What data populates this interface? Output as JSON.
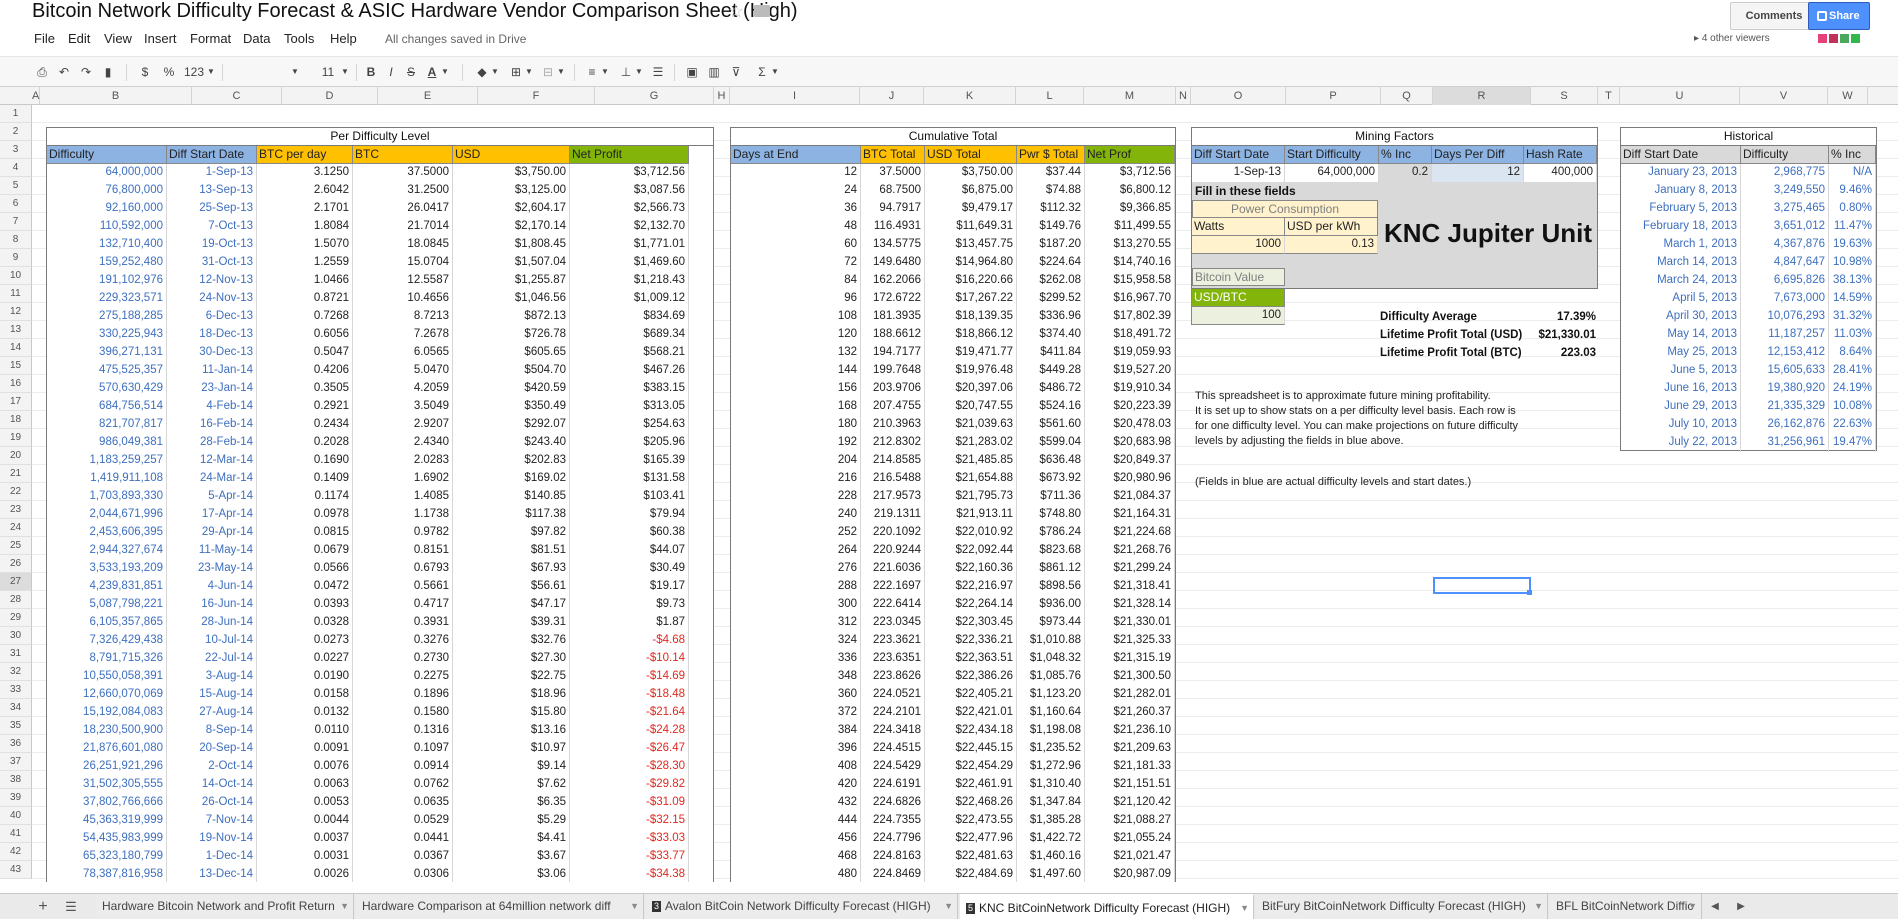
{
  "document": {
    "title": "Bitcoin Network Difficulty Forecast & ASIC Hardware Vendor Comparison Sheet (High)",
    "saved_status": "All changes saved in Drive",
    "comments_label": "Comments",
    "share_label": "Share",
    "viewers_label": "4 other viewers",
    "viewer_colors": [
      "#e8417a",
      "#c0325a",
      "#49a85c",
      "#30b84a"
    ]
  },
  "menu": [
    "File",
    "Edit",
    "View",
    "Insert",
    "Format",
    "Data",
    "Tools",
    "Help"
  ],
  "toolbar": {
    "currency": "$",
    "percent": "%",
    "number_format": "123",
    "font_size": "11"
  },
  "columns": [
    "A",
    "B",
    "C",
    "D",
    "E",
    "F",
    "G",
    "H",
    "I",
    "J",
    "K",
    "L",
    "M",
    "N",
    "O",
    "P",
    "Q",
    "R",
    "S",
    "T",
    "U",
    "V",
    "W"
  ],
  "rows": [
    "1",
    "2",
    "3",
    "4",
    "5",
    "6",
    "7",
    "8",
    "9",
    "10",
    "11",
    "12",
    "13",
    "14",
    "15",
    "16",
    "17",
    "18",
    "19",
    "20",
    "21",
    "22",
    "23",
    "24",
    "25",
    "26",
    "27",
    "28",
    "29",
    "30",
    "31",
    "32",
    "33",
    "34",
    "35",
    "36",
    "37",
    "38",
    "39",
    "40",
    "41",
    "42",
    "43"
  ],
  "selected_cell": {
    "column": "R",
    "row": "27"
  },
  "per_difficulty": {
    "title": "Per Difficulty Level",
    "headers": [
      "Difficulty",
      "Diff Start Date",
      "BTC per day",
      "BTC",
      "USD",
      "Net Profit"
    ],
    "rows": [
      [
        "64,000,000",
        "1-Sep-13",
        "3.1250",
        "37.5000",
        "$3,750.00",
        "$3,712.56"
      ],
      [
        "76,800,000",
        "13-Sep-13",
        "2.6042",
        "31.2500",
        "$3,125.00",
        "$3,087.56"
      ],
      [
        "92,160,000",
        "25-Sep-13",
        "2.1701",
        "26.0417",
        "$2,604.17",
        "$2,566.73"
      ],
      [
        "110,592,000",
        "7-Oct-13",
        "1.8084",
        "21.7014",
        "$2,170.14",
        "$2,132.70"
      ],
      [
        "132,710,400",
        "19-Oct-13",
        "1.5070",
        "18.0845",
        "$1,808.45",
        "$1,771.01"
      ],
      [
        "159,252,480",
        "31-Oct-13",
        "1.2559",
        "15.0704",
        "$1,507.04",
        "$1,469.60"
      ],
      [
        "191,102,976",
        "12-Nov-13",
        "1.0466",
        "12.5587",
        "$1,255.87",
        "$1,218.43"
      ],
      [
        "229,323,571",
        "24-Nov-13",
        "0.8721",
        "10.4656",
        "$1,046.56",
        "$1,009.12"
      ],
      [
        "275,188,285",
        "6-Dec-13",
        "0.7268",
        "8.7213",
        "$872.13",
        "$834.69"
      ],
      [
        "330,225,943",
        "18-Dec-13",
        "0.6056",
        "7.2678",
        "$726.78",
        "$689.34"
      ],
      [
        "396,271,131",
        "30-Dec-13",
        "0.5047",
        "6.0565",
        "$605.65",
        "$568.21"
      ],
      [
        "475,525,357",
        "11-Jan-14",
        "0.4206",
        "5.0470",
        "$504.70",
        "$467.26"
      ],
      [
        "570,630,429",
        "23-Jan-14",
        "0.3505",
        "4.2059",
        "$420.59",
        "$383.15"
      ],
      [
        "684,756,514",
        "4-Feb-14",
        "0.2921",
        "3.5049",
        "$350.49",
        "$313.05"
      ],
      [
        "821,707,817",
        "16-Feb-14",
        "0.2434",
        "2.9207",
        "$292.07",
        "$254.63"
      ],
      [
        "986,049,381",
        "28-Feb-14",
        "0.2028",
        "2.4340",
        "$243.40",
        "$205.96"
      ],
      [
        "1,183,259,257",
        "12-Mar-14",
        "0.1690",
        "2.0283",
        "$202.83",
        "$165.39"
      ],
      [
        "1,419,911,108",
        "24-Mar-14",
        "0.1409",
        "1.6902",
        "$169.02",
        "$131.58"
      ],
      [
        "1,703,893,330",
        "5-Apr-14",
        "0.1174",
        "1.4085",
        "$140.85",
        "$103.41"
      ],
      [
        "2,044,671,996",
        "17-Apr-14",
        "0.0978",
        "1.1738",
        "$117.38",
        "$79.94"
      ],
      [
        "2,453,606,395",
        "29-Apr-14",
        "0.0815",
        "0.9782",
        "$97.82",
        "$60.38"
      ],
      [
        "2,944,327,674",
        "11-May-14",
        "0.0679",
        "0.8151",
        "$81.51",
        "$44.07"
      ],
      [
        "3,533,193,209",
        "23-May-14",
        "0.0566",
        "0.6793",
        "$67.93",
        "$30.49"
      ],
      [
        "4,239,831,851",
        "4-Jun-14",
        "0.0472",
        "0.5661",
        "$56.61",
        "$19.17"
      ],
      [
        "5,087,798,221",
        "16-Jun-14",
        "0.0393",
        "0.4717",
        "$47.17",
        "$9.73"
      ],
      [
        "6,105,357,865",
        "28-Jun-14",
        "0.0328",
        "0.3931",
        "$39.31",
        "$1.87"
      ],
      [
        "7,326,429,438",
        "10-Jul-14",
        "0.0273",
        "0.3276",
        "$32.76",
        "-$4.68"
      ],
      [
        "8,791,715,326",
        "22-Jul-14",
        "0.0227",
        "0.2730",
        "$27.30",
        "-$10.14"
      ],
      [
        "10,550,058,391",
        "3-Aug-14",
        "0.0190",
        "0.2275",
        "$22.75",
        "-$14.69"
      ],
      [
        "12,660,070,069",
        "15-Aug-14",
        "0.0158",
        "0.1896",
        "$18.96",
        "-$18.48"
      ],
      [
        "15,192,084,083",
        "27-Aug-14",
        "0.0132",
        "0.1580",
        "$15.80",
        "-$21.64"
      ],
      [
        "18,230,500,900",
        "8-Sep-14",
        "0.0110",
        "0.1316",
        "$13.16",
        "-$24.28"
      ],
      [
        "21,876,601,080",
        "20-Sep-14",
        "0.0091",
        "0.1097",
        "$10.97",
        "-$26.47"
      ],
      [
        "26,251,921,296",
        "2-Oct-14",
        "0.0076",
        "0.0914",
        "$9.14",
        "-$28.30"
      ],
      [
        "31,502,305,555",
        "14-Oct-14",
        "0.0063",
        "0.0762",
        "$7.62",
        "-$29.82"
      ],
      [
        "37,802,766,666",
        "26-Oct-14",
        "0.0053",
        "0.0635",
        "$6.35",
        "-$31.09"
      ],
      [
        "45,363,319,999",
        "7-Nov-14",
        "0.0044",
        "0.0529",
        "$5.29",
        "-$32.15"
      ],
      [
        "54,435,983,999",
        "19-Nov-14",
        "0.0037",
        "0.0441",
        "$4.41",
        "-$33.03"
      ],
      [
        "65,323,180,799",
        "1-Dec-14",
        "0.0031",
        "0.0367",
        "$3.67",
        "-$33.77"
      ],
      [
        "78,387,816,958",
        "13-Dec-14",
        "0.0026",
        "0.0306",
        "$3.06",
        "-$34.38"
      ]
    ]
  },
  "cumulative": {
    "title": "Cumulative Total",
    "headers": [
      "Days at End",
      "BTC Total",
      "USD Total",
      "Pwr $ Total",
      "Net Prof"
    ],
    "rows": [
      [
        "12",
        "37.5000",
        "$3,750.00",
        "$37.44",
        "$3,712.56"
      ],
      [
        "24",
        "68.7500",
        "$6,875.00",
        "$74.88",
        "$6,800.12"
      ],
      [
        "36",
        "94.7917",
        "$9,479.17",
        "$112.32",
        "$9,366.85"
      ],
      [
        "48",
        "116.4931",
        "$11,649.31",
        "$149.76",
        "$11,499.55"
      ],
      [
        "60",
        "134.5775",
        "$13,457.75",
        "$187.20",
        "$13,270.55"
      ],
      [
        "72",
        "149.6480",
        "$14,964.80",
        "$224.64",
        "$14,740.16"
      ],
      [
        "84",
        "162.2066",
        "$16,220.66",
        "$262.08",
        "$15,958.58"
      ],
      [
        "96",
        "172.6722",
        "$17,267.22",
        "$299.52",
        "$16,967.70"
      ],
      [
        "108",
        "181.3935",
        "$18,139.35",
        "$336.96",
        "$17,802.39"
      ],
      [
        "120",
        "188.6612",
        "$18,866.12",
        "$374.40",
        "$18,491.72"
      ],
      [
        "132",
        "194.7177",
        "$19,471.77",
        "$411.84",
        "$19,059.93"
      ],
      [
        "144",
        "199.7648",
        "$19,976.48",
        "$449.28",
        "$19,527.20"
      ],
      [
        "156",
        "203.9706",
        "$20,397.06",
        "$486.72",
        "$19,910.34"
      ],
      [
        "168",
        "207.4755",
        "$20,747.55",
        "$524.16",
        "$20,223.39"
      ],
      [
        "180",
        "210.3963",
        "$21,039.63",
        "$561.60",
        "$20,478.03"
      ],
      [
        "192",
        "212.8302",
        "$21,283.02",
        "$599.04",
        "$20,683.98"
      ],
      [
        "204",
        "214.8585",
        "$21,485.85",
        "$636.48",
        "$20,849.37"
      ],
      [
        "216",
        "216.5488",
        "$21,654.88",
        "$673.92",
        "$20,980.96"
      ],
      [
        "228",
        "217.9573",
        "$21,795.73",
        "$711.36",
        "$21,084.37"
      ],
      [
        "240",
        "219.1311",
        "$21,913.11",
        "$748.80",
        "$21,164.31"
      ],
      [
        "252",
        "220.1092",
        "$22,010.92",
        "$786.24",
        "$21,224.68"
      ],
      [
        "264",
        "220.9244",
        "$22,092.44",
        "$823.68",
        "$21,268.76"
      ],
      [
        "276",
        "221.6036",
        "$22,160.36",
        "$861.12",
        "$21,299.24"
      ],
      [
        "288",
        "222.1697",
        "$22,216.97",
        "$898.56",
        "$21,318.41"
      ],
      [
        "300",
        "222.6414",
        "$22,264.14",
        "$936.00",
        "$21,328.14"
      ],
      [
        "312",
        "223.0345",
        "$22,303.45",
        "$973.44",
        "$21,330.01"
      ],
      [
        "324",
        "223.3621",
        "$22,336.21",
        "$1,010.88",
        "$21,325.33"
      ],
      [
        "336",
        "223.6351",
        "$22,363.51",
        "$1,048.32",
        "$21,315.19"
      ],
      [
        "348",
        "223.8626",
        "$22,386.26",
        "$1,085.76",
        "$21,300.50"
      ],
      [
        "360",
        "224.0521",
        "$22,405.21",
        "$1,123.20",
        "$21,282.01"
      ],
      [
        "372",
        "224.2101",
        "$22,421.01",
        "$1,160.64",
        "$21,260.37"
      ],
      [
        "384",
        "224.3418",
        "$22,434.18",
        "$1,198.08",
        "$21,236.10"
      ],
      [
        "396",
        "224.4515",
        "$22,445.15",
        "$1,235.52",
        "$21,209.63"
      ],
      [
        "408",
        "224.5429",
        "$22,454.29",
        "$1,272.96",
        "$21,181.33"
      ],
      [
        "420",
        "224.6191",
        "$22,461.91",
        "$1,310.40",
        "$21,151.51"
      ],
      [
        "432",
        "224.6826",
        "$22,468.26",
        "$1,347.84",
        "$21,120.42"
      ],
      [
        "444",
        "224.7355",
        "$22,473.55",
        "$1,385.28",
        "$21,088.27"
      ],
      [
        "456",
        "224.7796",
        "$22,477.96",
        "$1,422.72",
        "$21,055.24"
      ],
      [
        "468",
        "224.8163",
        "$22,481.63",
        "$1,460.16",
        "$21,021.47"
      ],
      [
        "480",
        "224.8469",
        "$22,484.69",
        "$1,497.60",
        "$20,987.09"
      ]
    ]
  },
  "mining_factors": {
    "title": "Mining Factors",
    "headers": [
      "Diff Start Date",
      "Start Difficulty",
      "% Inc",
      "Days Per Diff",
      "Hash Rate"
    ],
    "values": [
      "1-Sep-13",
      "64,000,000",
      "0.2",
      "12",
      "400,000"
    ],
    "fill_label": "Fill in these fields",
    "power_title": "Power Consumption",
    "watts_label": "Watts",
    "usd_kwh_label": "USD per kWh",
    "watts_value": "1000",
    "usd_kwh_value": "0.13",
    "unit_name": "KNC Jupiter Unit",
    "bitcoin_value_label": "Bitcoin Value",
    "usd_btc_label": "USD/BTC",
    "usd_btc_value": "100",
    "difficulty_avg_label": "Difficulty Average",
    "difficulty_avg_value": "17.39%",
    "lifetime_usd_label": "Lifetime Profit Total (USD)",
    "lifetime_usd_value": "$21,330.01",
    "lifetime_btc_label": "Lifetime Profit Total (BTC)",
    "lifetime_btc_value": "223.03",
    "note_lines": [
      "This spreadsheet is to approximate future mining profitability.",
      "It is set up to show stats on a per difficulty level basis. Each row is",
      "for one difficulty level. You can make projections on future difficulty",
      "levels by adjusting the fields in blue above."
    ],
    "note_blue": "(Fields in blue are actual difficulty levels and start dates.)"
  },
  "historical": {
    "title": "Historical",
    "headers": [
      "Diff Start Date",
      "Difficulty",
      "% Inc"
    ],
    "rows": [
      [
        "January 23, 2013",
        "2,968,775",
        "N/A"
      ],
      [
        "January 8, 2013",
        "3,249,550",
        "9.46%"
      ],
      [
        "February 5, 2013",
        "3,275,465",
        "0.80%"
      ],
      [
        "February 18, 2013",
        "3,651,012",
        "11.47%"
      ],
      [
        "March 1, 2013",
        "4,367,876",
        "19.63%"
      ],
      [
        "March 14, 2013",
        "4,847,647",
        "10.98%"
      ],
      [
        "March 24, 2013",
        "6,695,826",
        "38.13%"
      ],
      [
        "April 5, 2013",
        "7,673,000",
        "14.59%"
      ],
      [
        "April 30, 2013",
        "10,076,293",
        "31.32%"
      ],
      [
        "May 14, 2013",
        "11,187,257",
        "11.03%"
      ],
      [
        "May 25, 2013",
        "12,153,412",
        "8.64%"
      ],
      [
        "June 5, 2013",
        "15,605,633",
        "28.41%"
      ],
      [
        "June 16, 2013",
        "19,380,920",
        "24.19%"
      ],
      [
        "June 29, 2013",
        "21,335,329",
        "10.08%"
      ],
      [
        "July 10, 2013",
        "26,162,876",
        "22.63%"
      ],
      [
        "July 22, 2013",
        "31,256,961",
        "19.47%"
      ]
    ]
  },
  "colors": {
    "header_blue": "#8db3e2",
    "header_orange": "#ffc000",
    "header_green": "#82b40a",
    "link_blue": "#3d6fbf",
    "negative_red": "#e0291f",
    "input_yellow": "#fff2cc",
    "panel_gray": "#d9d9d9",
    "light_blue_cell": "#dbe5f1",
    "light_green_cell": "#ebf1de"
  },
  "sheet_tabs": [
    {
      "label": "Hardware Bitcoin Network and Profit Return",
      "badge": "",
      "active": false
    },
    {
      "label": "Hardware Comparison at 64million network diff",
      "badge": "",
      "active": false
    },
    {
      "label": "Avalon BitCoin Network Difficulty Forecast (HIGH)",
      "badge": "3",
      "active": false
    },
    {
      "label": "KNC BitCoinNetwork Difficulty Forecast (HIGH)",
      "badge": "5",
      "active": true
    },
    {
      "label": "BitFury BitCoinNetwork Difficulty Forecast (HIGH)",
      "badge": "",
      "active": false
    },
    {
      "label": "BFL BitCoinNetwork Diffic",
      "badge": "",
      "active": false
    }
  ]
}
